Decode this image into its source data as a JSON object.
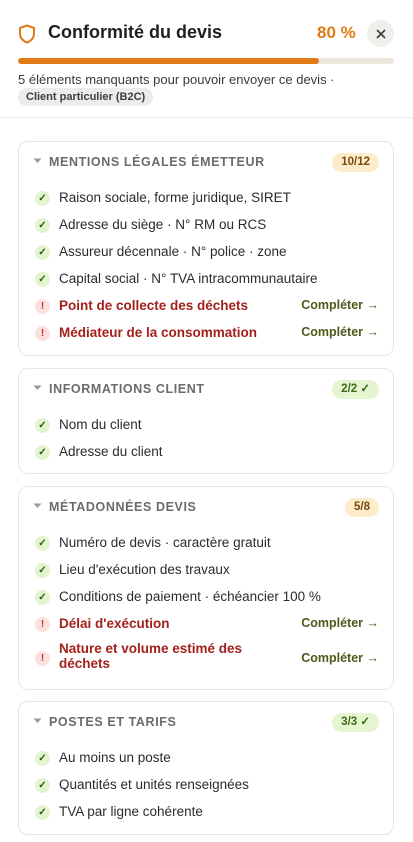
{
  "header": {
    "title": "Conformité du devis",
    "percent": "80 %",
    "progress": 0.8,
    "subtitle": "5 éléments manquants pour pouvoir envoyer ce devis ·",
    "client_type": "Client particulier (B2C)"
  },
  "colors": {
    "accent": "#e07a14",
    "missing": "#a3201c",
    "ok": "#2e5d12"
  },
  "sections": [
    {
      "title": "MENTIONS LÉGALES ÉMETTEUR",
      "count": "10/12",
      "items": [
        {
          "label": "Raison sociale, forme juridique, SIRET",
          "status": "ok"
        },
        {
          "label": "Adresse du siège · N° RM ou RCS",
          "status": "ok"
        },
        {
          "label": "Assureur décennale · N° police · zone",
          "status": "ok"
        },
        {
          "label": "Capital social · N° TVA intracommunautaire",
          "status": "ok"
        },
        {
          "label": "Point de collecte des déchets",
          "status": "missing",
          "action": "Compléter →"
        },
        {
          "label": "Médiateur de la consommation",
          "status": "missing",
          "action": "Compléter →"
        }
      ]
    },
    {
      "title": "INFORMATIONS CLIENT",
      "count": "2/2 ✓",
      "items": [
        {
          "label": "Nom du client",
          "status": "ok"
        },
        {
          "label": "Adresse du client",
          "status": "ok"
        }
      ]
    },
    {
      "title": "MÉTADONNÉES DEVIS",
      "count": "5/8",
      "items": [
        {
          "label": "Numéro de devis · caractère gratuit",
          "status": "ok"
        },
        {
          "label": "Lieu d'exécution des travaux",
          "status": "ok"
        },
        {
          "label": "Conditions de paiement · échéancier 100 %",
          "status": "ok"
        },
        {
          "label": "Délai d'exécution",
          "status": "missing",
          "action": "Compléter →"
        },
        {
          "label": "Nature et volume estimé des déchets",
          "status": "missing",
          "action": "Compléter →"
        }
      ]
    },
    {
      "title": "POSTES ET TARIFS",
      "count": "3/3 ✓",
      "items": [
        {
          "label": "Au moins un poste",
          "status": "ok"
        },
        {
          "label": "Quantités et unités renseignées",
          "status": "ok"
        },
        {
          "label": "TVA par ligne cohérente",
          "status": "ok"
        }
      ]
    }
  ]
}
